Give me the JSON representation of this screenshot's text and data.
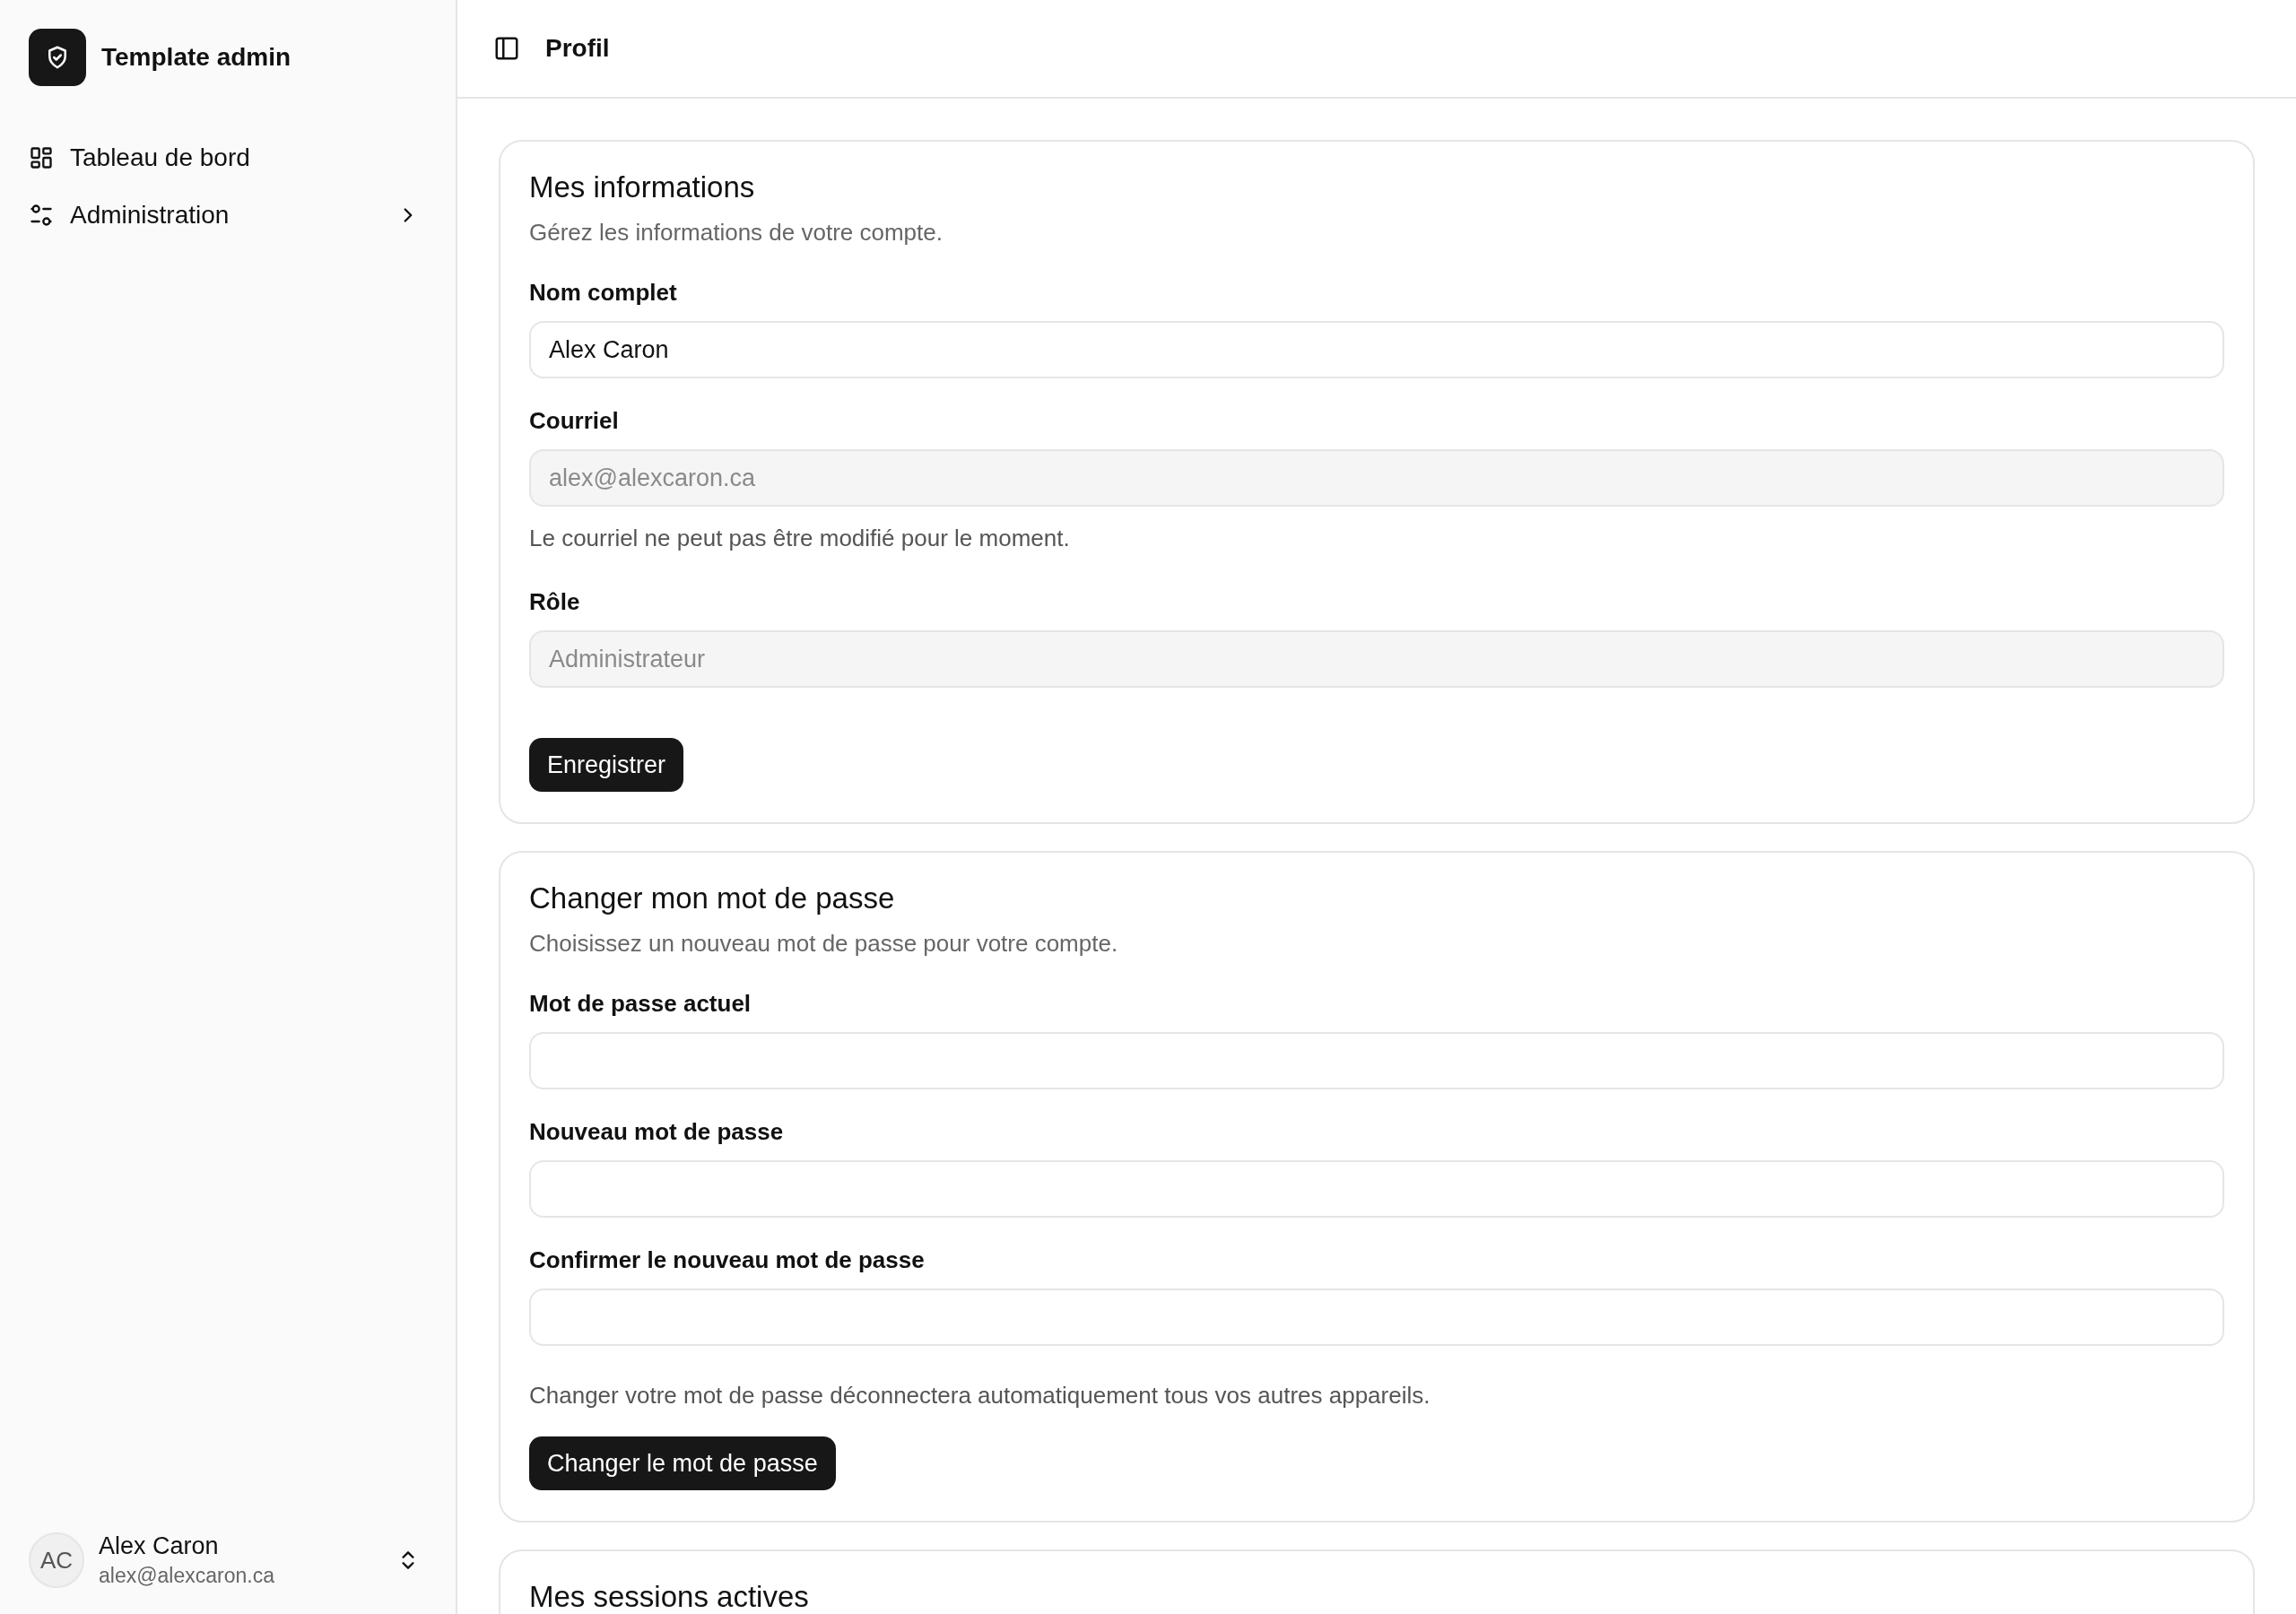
{
  "sidebar": {
    "brand": "Template admin",
    "nav": [
      {
        "label": "Tableau de bord",
        "expandable": false
      },
      {
        "label": "Administration",
        "expandable": true
      }
    ],
    "user": {
      "initials": "AC",
      "name": "Alex Caron",
      "email": "alex@alexcaron.ca"
    }
  },
  "header": {
    "title": "Profil"
  },
  "sections": [
    {
      "title": "Mes informations",
      "description": "Gérez les informations de votre compte.",
      "fields": [
        {
          "label": "Nom complet",
          "value": "Alex Caron",
          "disabled": false
        },
        {
          "label": "Courriel",
          "value": "alex@alexcaron.ca",
          "disabled": true,
          "help": "Le courriel ne peut pas être modifié pour le moment."
        },
        {
          "label": "Rôle",
          "value": "Administrateur",
          "disabled": true
        }
      ],
      "button": "Enregistrer"
    },
    {
      "title": "Changer mon mot de passe",
      "description": "Choisissez un nouveau mot de passe pour votre compte.",
      "fields": [
        {
          "label": "Mot de passe actuel"
        },
        {
          "label": "Nouveau mot de passe"
        },
        {
          "label": "Confirmer le nouveau mot de passe"
        }
      ],
      "note": "Changer votre mot de passe déconnectera automatiquement tous vos autres appareils.",
      "button": "Changer le mot de passe"
    },
    {
      "title": "Mes sessions actives"
    }
  ]
}
